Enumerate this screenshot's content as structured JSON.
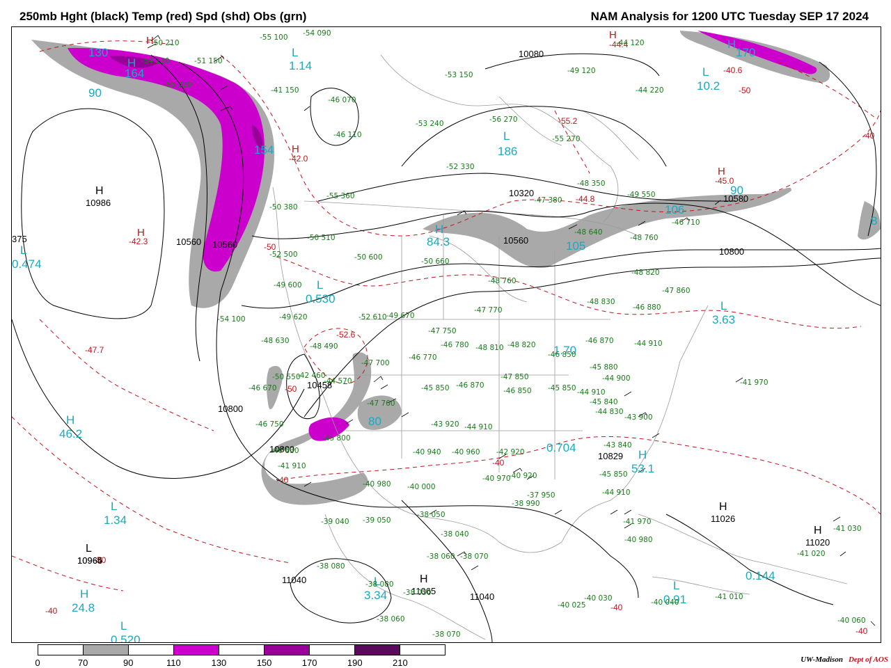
{
  "header": {
    "left_title": "250mb Hght (black) Temp (red) Spd (shd) Obs (grn)",
    "right_title": "NAM Analysis for 1200 UTC Tuesday  SEP 17 2024"
  },
  "colors": {
    "height_contour": "#000000",
    "temp_contour": "#c0141a",
    "obs": "#1a7a1a",
    "hl_cyan": "#1ba9bf",
    "speed_70_90": "#a9a9a9",
    "speed_110_130": "#cc00cc",
    "speed_150_170": "#990099",
    "speed_190_210": "#5a0a5a"
  },
  "legend": {
    "ticks": [
      "0",
      "70",
      "90",
      "110",
      "130",
      "150",
      "170",
      "190",
      "210"
    ],
    "fills": [
      "#ffffff",
      "#a9a9a9",
      "#ffffff",
      "#cc00cc",
      "#ffffff",
      "#990099",
      "#ffffff",
      "#5a0a5a",
      "#ffffff"
    ]
  },
  "credit": {
    "org": "UW-Madison",
    "dept": "Dept of AOS"
  },
  "height_labels": [
    "10986",
    "10800",
    "10560",
    "10560",
    "10320",
    "10080",
    "10560",
    "10800",
    "10458",
    "10800",
    "10829",
    "11026",
    "11020",
    "11040",
    "11040",
    "10965",
    "10964",
    "375",
    "11065",
    "10580"
  ],
  "cyan_labels": [
    "L",
    "1.14",
    "H",
    "164",
    "130",
    "90",
    "154",
    "L",
    "0.474",
    "L",
    "0.530",
    "H",
    "84.3",
    "L",
    "186",
    "106",
    "105",
    "90",
    "L",
    "3.63",
    "1.70",
    "80",
    "H",
    "46.2",
    "L",
    "1.34",
    "H",
    "24.8",
    "L",
    "0.520",
    "L",
    "3.34",
    "L",
    "0.91",
    "0.144",
    "H",
    "53.1",
    "0.704",
    "H",
    "170",
    "L",
    "10.2",
    "8"
  ],
  "red_labels": [
    "H",
    "-42.0",
    "H",
    "-42.3",
    "-47.7",
    "-52.6",
    "H",
    "-44.4",
    "-40.6",
    "-55.2",
    "-44.8",
    "H",
    "-45.0",
    "-40",
    "-40",
    "-40",
    "-40",
    "-40",
    "-50",
    "-50",
    "-50",
    "-50",
    "-40"
  ],
  "hl_letters": [
    "H",
    "H",
    "H",
    "L",
    "H"
  ],
  "obs": [
    "-54 090",
    "-55 100",
    "-41 150",
    "-46 070",
    "-46 110",
    "-53 240",
    "-56 270",
    "-55 270",
    "-53 150",
    "-52 330",
    "-48 350",
    "-47 380",
    "-49 550",
    "-48 640",
    "-48 760",
    "-46 710",
    "-55 360",
    "-50 380",
    "-50 510",
    "-52 500",
    "-50 600",
    "-50 660",
    "-48 760",
    "-49 600",
    "-49 620",
    "-52 610",
    "-49 670",
    "-47 770",
    "-47 750",
    "-48 630",
    "-48 490",
    "-46 780",
    "-47 700",
    "-46 770",
    "-48 810",
    "-48 820",
    "-46 850",
    "-46 870",
    "-44 910",
    "-50 550",
    "-46 670",
    "-42 460",
    "-44 570",
    "-47 760",
    "-45 850",
    "-46 870",
    "-47 850",
    "-46 850",
    "-45 850",
    "-44 910",
    "-43 920",
    "-44 910",
    "-45 880",
    "-44 900",
    "-45 840",
    "-44 830",
    "-43 900",
    "-43 840",
    "-45 850",
    "-44 910",
    "-41 970",
    "-40 980",
    "-41 910",
    "-46 750",
    "-40 830",
    "-45 800",
    "-40 940",
    "-40 960",
    "-42 920",
    "-40 920",
    "-40 970",
    "-38 990",
    "-37 950",
    "-40 980",
    "-40 000",
    "-39 040",
    "-39 050",
    "-38 050",
    "-38 040",
    "-38 080",
    "-38 060",
    "-38 080",
    "-38 050",
    "-38 070",
    "-38 060",
    "-38 070",
    "-40 030",
    "-40 025",
    "-40 040",
    "-41 010",
    "-41 020",
    "-41 030",
    "-40 060",
    "-41 970",
    "-48 830",
    "-48 820",
    "-47 860",
    "-46 880",
    "-44 120",
    "-49 120",
    "-44 220",
    "-50 210",
    "-51 150",
    "-55 320",
    "-54 130",
    "-54 100"
  ]
}
